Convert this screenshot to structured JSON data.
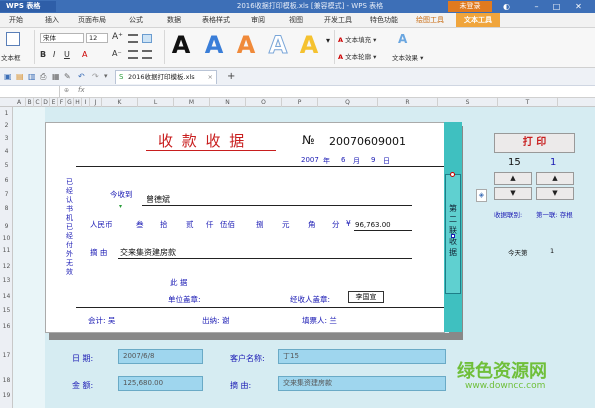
{
  "app": {
    "name": "WPS 表格",
    "window_title": "2016收据打印模板.xls [兼容模式] - WPS 表格",
    "login_label": "未登录"
  },
  "menu": {
    "items": [
      "开始",
      "插入",
      "页面布局",
      "公式",
      "数据",
      "表格样式",
      "审阅",
      "视图",
      "开发工具",
      "特色功能",
      "绘图工具",
      "文本工具"
    ],
    "active_index": 11
  },
  "ribbon": {
    "textbox_label": "文本框",
    "font_name": "宋体",
    "font_size": "12",
    "wordart_fill": "文本填充",
    "wordart_outline": "文本轮廓",
    "wordart_effect": "文本效果",
    "wordart_samples": [
      "A",
      "A",
      "A",
      "A",
      "A"
    ]
  },
  "file_tab": "2016收据打印模板.xls",
  "formula_bar": {
    "fx": "fx"
  },
  "columns": [
    "A",
    "B",
    "C",
    "D",
    "E",
    "F",
    "G",
    "H",
    "I",
    "J",
    "K",
    "L",
    "M",
    "N",
    "O",
    "P",
    "Q",
    "R",
    "S",
    "T"
  ],
  "rows": [
    "1",
    "2",
    "3",
    "4",
    "5",
    "6",
    "7",
    "8",
    "9",
    "10",
    "11",
    "12",
    "13",
    "14",
    "15",
    "16",
    "17",
    "18",
    "19"
  ],
  "receipt": {
    "title": "收 款 收 据",
    "no_prefix": "№",
    "number": "20070609001",
    "date_year": "2007",
    "date_year_unit": "年",
    "date_month": "6",
    "date_month_unit": "月",
    "date_day": "9",
    "date_day_unit": "日",
    "received_from_label": "今收到",
    "received_from": "曾德斌",
    "amount_label": "人民币",
    "amount_units": [
      "叁",
      "拾",
      "贰",
      "仟",
      "伍佰",
      "捌",
      "元",
      "角",
      "分"
    ],
    "amount_symbol": "¥",
    "amount_value": "96,763.00",
    "reason_label": "摘  由",
    "reason": "交来集资建房款",
    "evidence_label": "此    据",
    "unit_seal_label": "单位盖章:",
    "handler_label": "经收人盖章:",
    "seal_text": "李国宣",
    "side_text": "已经认书机已经付外无效",
    "accountant": "会计: 吴",
    "cashier": "出纳: 谢",
    "filler": "填票人: 兰",
    "panel_text": "第二联 收据"
  },
  "controls": {
    "print_label": "打   印",
    "copies": "15",
    "page": "1",
    "up_arrow": "▲",
    "down_arrow": "▼",
    "receipt_copy_label": "收据联别:",
    "receipt_copy_value": "第一联: 存根",
    "today_label": "今天第",
    "today_value": "1"
  },
  "form": {
    "date_label": "日    期:",
    "date_value": "2007/6/8",
    "customer_label": "客户名称:",
    "customer_value": "丁15",
    "amount_label": "金    额:",
    "amount_value": "125,680.00",
    "reason_label": "摘    由:",
    "reason_value": "交来集资建房款"
  },
  "watermark": {
    "logo": "绿色资源网",
    "url": "www.downcc.com"
  },
  "colors": {
    "accent": "#3fc0c0",
    "sheet_bg": "#d6ecf2",
    "red": "#c81e1e",
    "title_blue": "#3d6fb7"
  }
}
